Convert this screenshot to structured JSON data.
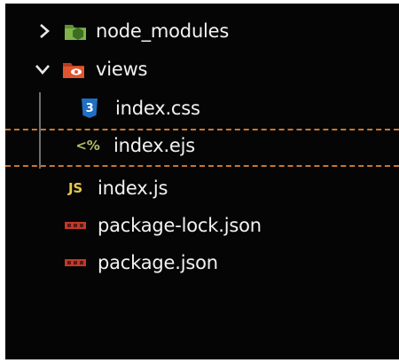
{
  "explorer": {
    "items": [
      {
        "label": "node_modules",
        "icon": "node-folder-icon",
        "chevron": "chevron-right-icon"
      },
      {
        "label": "views",
        "icon": "views-folder-icon",
        "chevron": "chevron-down-icon"
      },
      {
        "label": "index.css",
        "icon": "css-file-icon"
      },
      {
        "label": "index.ejs",
        "icon": "ejs-file-icon",
        "icon_text": "<%"
      },
      {
        "label": "index.js",
        "icon": "js-file-icon",
        "icon_text": "JS"
      },
      {
        "label": "package-lock.json",
        "icon": "npm-json-icon"
      },
      {
        "label": "package.json",
        "icon": "npm-json-icon"
      }
    ],
    "css_icon_text": "3"
  },
  "colors": {
    "background": "#050505",
    "text": "#f2f2f2",
    "node_folder": "#7fb24a",
    "views_folder": "#e0552e",
    "css": "#1f6fc4",
    "ejs": "#b2c06a",
    "js": "#e8c84a",
    "npm": "#c0392b",
    "selection_border": "#c9762e"
  }
}
